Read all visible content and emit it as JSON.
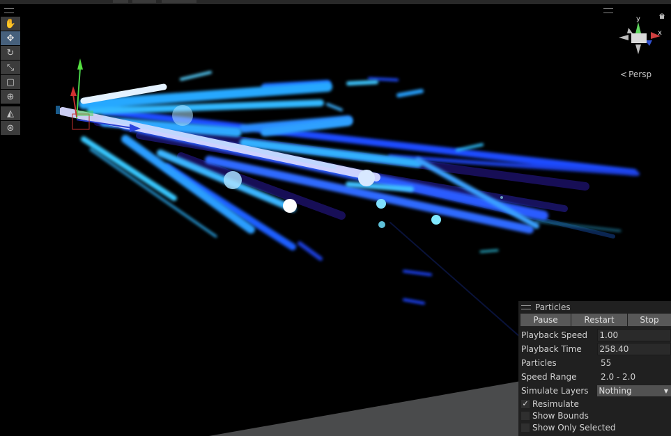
{
  "toolbar": {
    "tools": [
      {
        "name": "hand-tool",
        "icon": "hand-icon",
        "glyph": "✋"
      },
      {
        "name": "move-tool",
        "icon": "move-icon",
        "glyph": "✥",
        "active": true
      },
      {
        "name": "rotate-tool",
        "icon": "rotate-icon",
        "glyph": "↻"
      },
      {
        "name": "scale-tool",
        "icon": "scale-icon",
        "glyph": "⤡"
      },
      {
        "name": "rect-tool",
        "icon": "rect-icon",
        "glyph": "▢"
      },
      {
        "name": "transform-tool",
        "icon": "transform-icon",
        "glyph": "⊕"
      }
    ],
    "extra_tools": [
      {
        "name": "custom-editor-tool",
        "icon": "editor-tool-icon",
        "glyph": "◭"
      },
      {
        "name": "pivot-tool",
        "icon": "pivot-icon",
        "glyph": "⊛"
      }
    ]
  },
  "gizmo": {
    "x_label": "x",
    "y_label": "y",
    "projection": "Persp"
  },
  "particles_panel": {
    "title": "Particles",
    "buttons": {
      "pause": "Pause",
      "restart": "Restart",
      "stop": "Stop"
    },
    "playback_speed": {
      "label": "Playback Speed",
      "value": "1.00"
    },
    "playback_time": {
      "label": "Playback Time",
      "value": "258.40"
    },
    "particles": {
      "label": "Particles",
      "value": "55"
    },
    "speed_range": {
      "label": "Speed Range",
      "value": "2.0 - 2.0"
    },
    "simulate_layers": {
      "label": "Simulate Layers",
      "value": "Nothing"
    },
    "resimulate": {
      "label": "Resimulate",
      "checked": true
    },
    "show_bounds": {
      "label": "Show Bounds",
      "checked": false
    },
    "show_only_selected": {
      "label": "Show Only Selected",
      "checked": false
    }
  },
  "colors": {
    "panel_bg": "#202020",
    "button_bg": "#585858",
    "particle_blue": "#1f5bff",
    "particle_cyan": "#39c8ff",
    "ground": "#4a4b4c"
  }
}
